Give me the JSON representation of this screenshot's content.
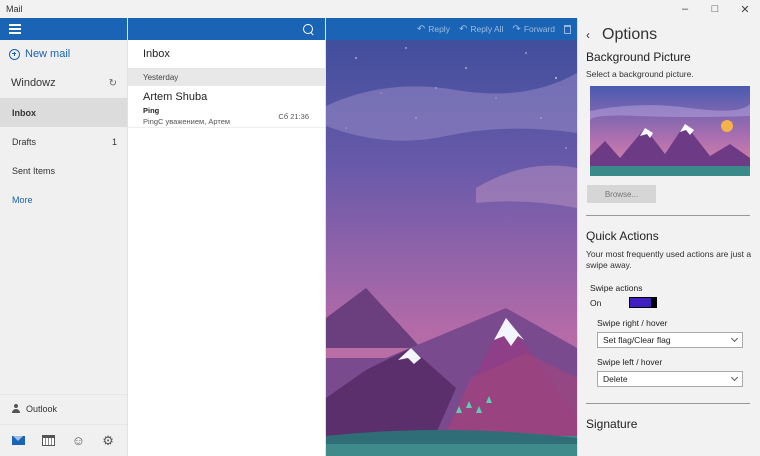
{
  "window": {
    "title": "Mail"
  },
  "nav": {
    "new_mail": "New mail",
    "account": "Windowz",
    "folders": [
      {
        "label": "Inbox",
        "count": "",
        "selected": true
      },
      {
        "label": "Drafts",
        "count": "1",
        "selected": false
      },
      {
        "label": "Sent Items",
        "count": "",
        "selected": false
      }
    ],
    "more": "More",
    "outlook": "Outlook"
  },
  "list": {
    "title": "Inbox",
    "date_group": "Yesterday",
    "messages": [
      {
        "sender": "Artem Shuba",
        "subject": "Ping",
        "preview": "PingС уважением, Артем",
        "time": "Сб 21:36"
      }
    ]
  },
  "reading": {
    "toolbar": {
      "reply": "Reply",
      "reply_all": "Reply All",
      "forward": "Forward"
    }
  },
  "options": {
    "title": "Options",
    "background": {
      "title": "Background Picture",
      "desc": "Select a background picture.",
      "browse": "Browse..."
    },
    "quick_actions": {
      "title": "Quick Actions",
      "desc": "Your most frequently used actions are just a swipe away.",
      "swipe_actions_label": "Swipe actions",
      "swipe_state": "On",
      "swipe_right_label": "Swipe right / hover",
      "swipe_right_value": "Set flag/Clear flag",
      "swipe_left_label": "Swipe left / hover",
      "swipe_left_value": "Delete"
    },
    "signature": {
      "title": "Signature"
    }
  },
  "colors": {
    "accent": "#1a63b5",
    "toggle_on": "#3f1fbf"
  }
}
